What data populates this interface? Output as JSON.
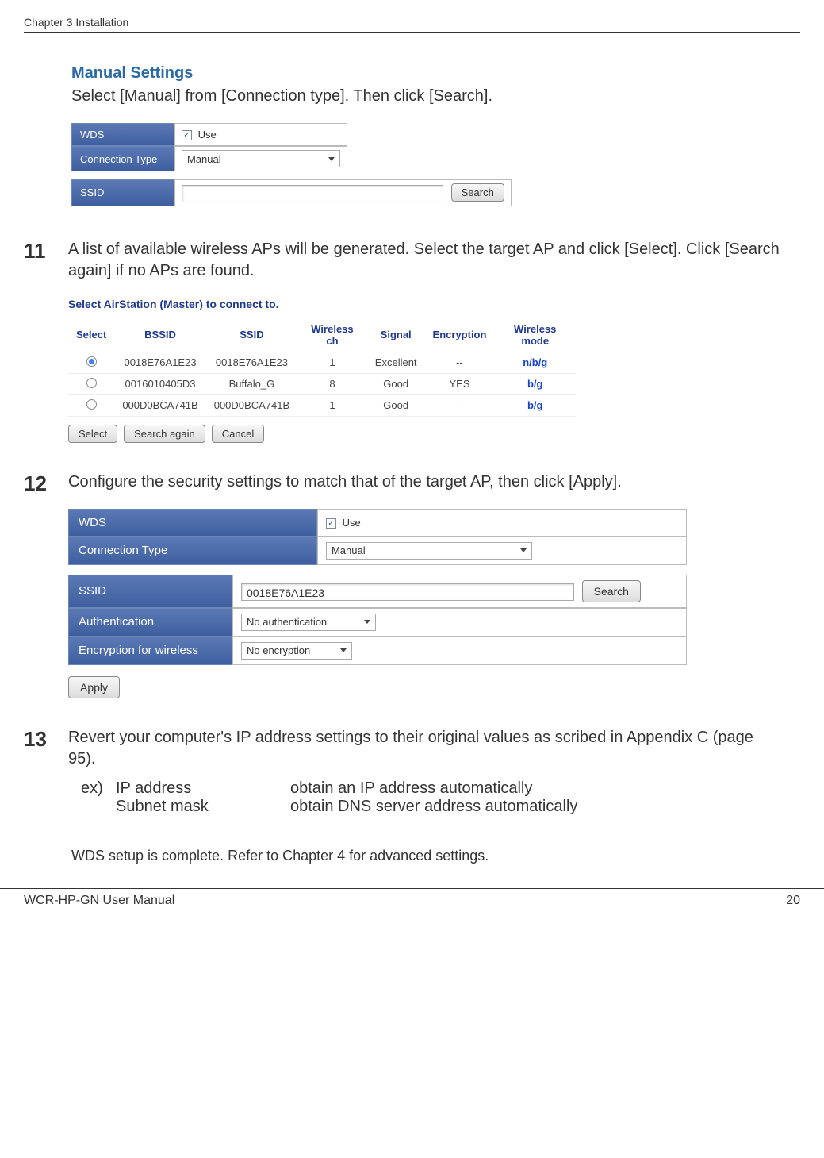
{
  "header": {
    "chapter": "Chapter 3  Installation"
  },
  "intro": {
    "title": "Manual Settings",
    "text": "Select [Manual] from [Connection type].  Then click [Search]."
  },
  "fig1": {
    "wds_label": "WDS",
    "wds_use": "Use",
    "conn_label": "Connection Type",
    "conn_value": "Manual",
    "ssid_label": "SSID",
    "search_btn": "Search"
  },
  "step11": {
    "num": "11",
    "text": "A list of available wireless APs will be generated. Select the target AP and click [Select]. Click [Search again] if no APs are found.",
    "fig": {
      "title": "Select AirStation (Master) to connect to.",
      "headers": [
        "Select",
        "BSSID",
        "SSID",
        "Wireless ch",
        "Signal",
        "Encryption",
        "Wireless mode"
      ],
      "rows": [
        {
          "checked": true,
          "bssid": "0018E76A1E23",
          "ssid": "0018E76A1E23",
          "ch": "1",
          "signal": "Excellent",
          "enc": "--",
          "mode": "n/b/g"
        },
        {
          "checked": false,
          "bssid": "0016010405D3",
          "ssid": "Buffalo_G",
          "ch": "8",
          "signal": "Good",
          "enc": "YES",
          "mode": "b/g"
        },
        {
          "checked": false,
          "bssid": "000D0BCA741B",
          "ssid": "000D0BCA741B",
          "ch": "1",
          "signal": "Good",
          "enc": "--",
          "mode": "b/g"
        }
      ],
      "buttons": {
        "select": "Select",
        "search_again": "Search again",
        "cancel": "Cancel"
      }
    }
  },
  "step12": {
    "num": "12",
    "text": "Configure the security settings to match that of the target AP, then click [Apply].",
    "fig": {
      "wds_label": "WDS",
      "wds_use": "Use",
      "conn_label": "Connection Type",
      "conn_value": "Manual",
      "ssid_label": "SSID",
      "ssid_value": "0018E76A1E23",
      "search_btn": "Search",
      "auth_label": "Authentication",
      "auth_value": "No authentication",
      "encw_label": "Encryption for wireless",
      "encw_value": "No encryption",
      "apply_btn": "Apply"
    }
  },
  "step13": {
    "num": "13",
    "text": "Revert your computer's IP address settings to their original values as scribed in Appendix C (page 95).",
    "ex_label": "ex)",
    "rows": [
      {
        "left": "IP address",
        "right": "obtain an IP address automatically"
      },
      {
        "left": "Subnet mask",
        "right": "obtain DNS server address automatically"
      }
    ]
  },
  "closing": "WDS setup is complete. Refer to Chapter 4 for advanced settings.",
  "footer": {
    "manual": "WCR-HP-GN User Manual",
    "page": "20"
  }
}
